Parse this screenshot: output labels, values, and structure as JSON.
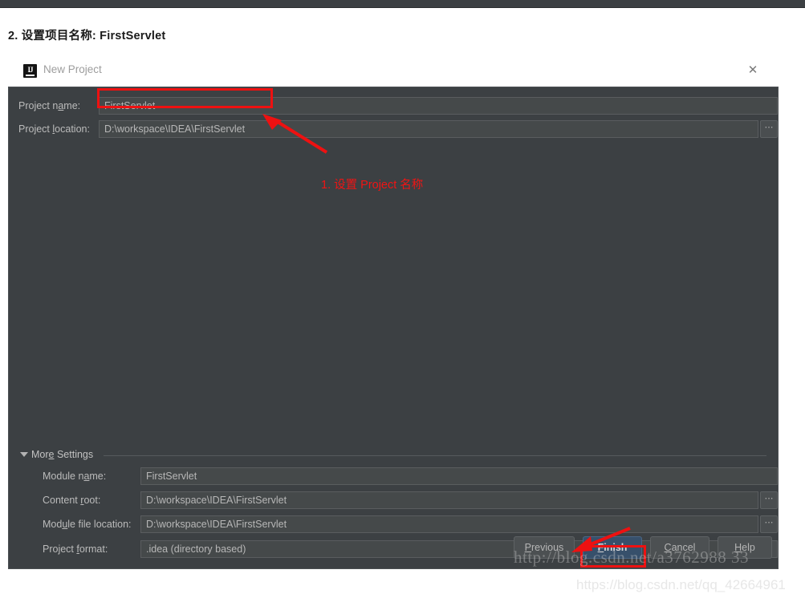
{
  "article": {
    "heading": "2. 设置项目名称: FirstServlet"
  },
  "dialog": {
    "title": "New Project",
    "logo_text": "IJ",
    "close_icon": "✕",
    "fields": [
      {
        "label_pre": "Project n",
        "label_mn": "a",
        "label_post": "me:",
        "value": "FirstServlet"
      },
      {
        "label_pre": "Project ",
        "label_mn": "l",
        "label_post": "ocation:",
        "value": "D:\\workspace\\IDEA\\FirstServlet"
      }
    ],
    "more_settings": {
      "label_pre": "Mor",
      "label_mn": "e",
      "label_post": " Settings",
      "expanded": true,
      "fields": [
        {
          "label_pre": "Module n",
          "label_mn": "a",
          "label_post": "me:",
          "value": "FirstServlet",
          "browse": false,
          "dropdown": false
        },
        {
          "label_pre": "Content ",
          "label_mn": "r",
          "label_post": "oot:",
          "value": "D:\\workspace\\IDEA\\FirstServlet",
          "browse": true,
          "dropdown": false
        },
        {
          "label_pre": "Mod",
          "label_mn": "u",
          "label_post": "le file location:",
          "value": "D:\\workspace\\IDEA\\FirstServlet",
          "browse": true,
          "dropdown": false
        },
        {
          "label_pre": "Project ",
          "label_mn": "f",
          "label_post": "ormat:",
          "value": ".idea (directory based)",
          "browse": false,
          "dropdown": true
        }
      ]
    },
    "buttons": [
      {
        "label_pre": "",
        "label_mn": "P",
        "label_post": "revious",
        "primary": false
      },
      {
        "label_pre": "",
        "label_mn": "F",
        "label_post": "inish",
        "primary": true
      },
      {
        "label_pre": "",
        "label_mn": "C",
        "label_post": "ancel",
        "primary": false
      },
      {
        "label_pre": "",
        "label_mn": "H",
        "label_post": "elp",
        "primary": false
      }
    ],
    "browse_glyph": "⋯",
    "dropdown_glyph": "▼"
  },
  "annotations": {
    "step_text": "1. 设置 Project 名称",
    "color": "#ee1111"
  },
  "watermarks": {
    "upper": "http://blog.csdn.net/a3762988 33",
    "lower": "https://blog.csdn.net/qq_42664961"
  },
  "colors": {
    "dialog_bg": "#3c4043",
    "field_bg": "#45494a",
    "accent_red": "#ee1111",
    "focus_blue": "#37506b",
    "text": "#bbbbbb"
  }
}
